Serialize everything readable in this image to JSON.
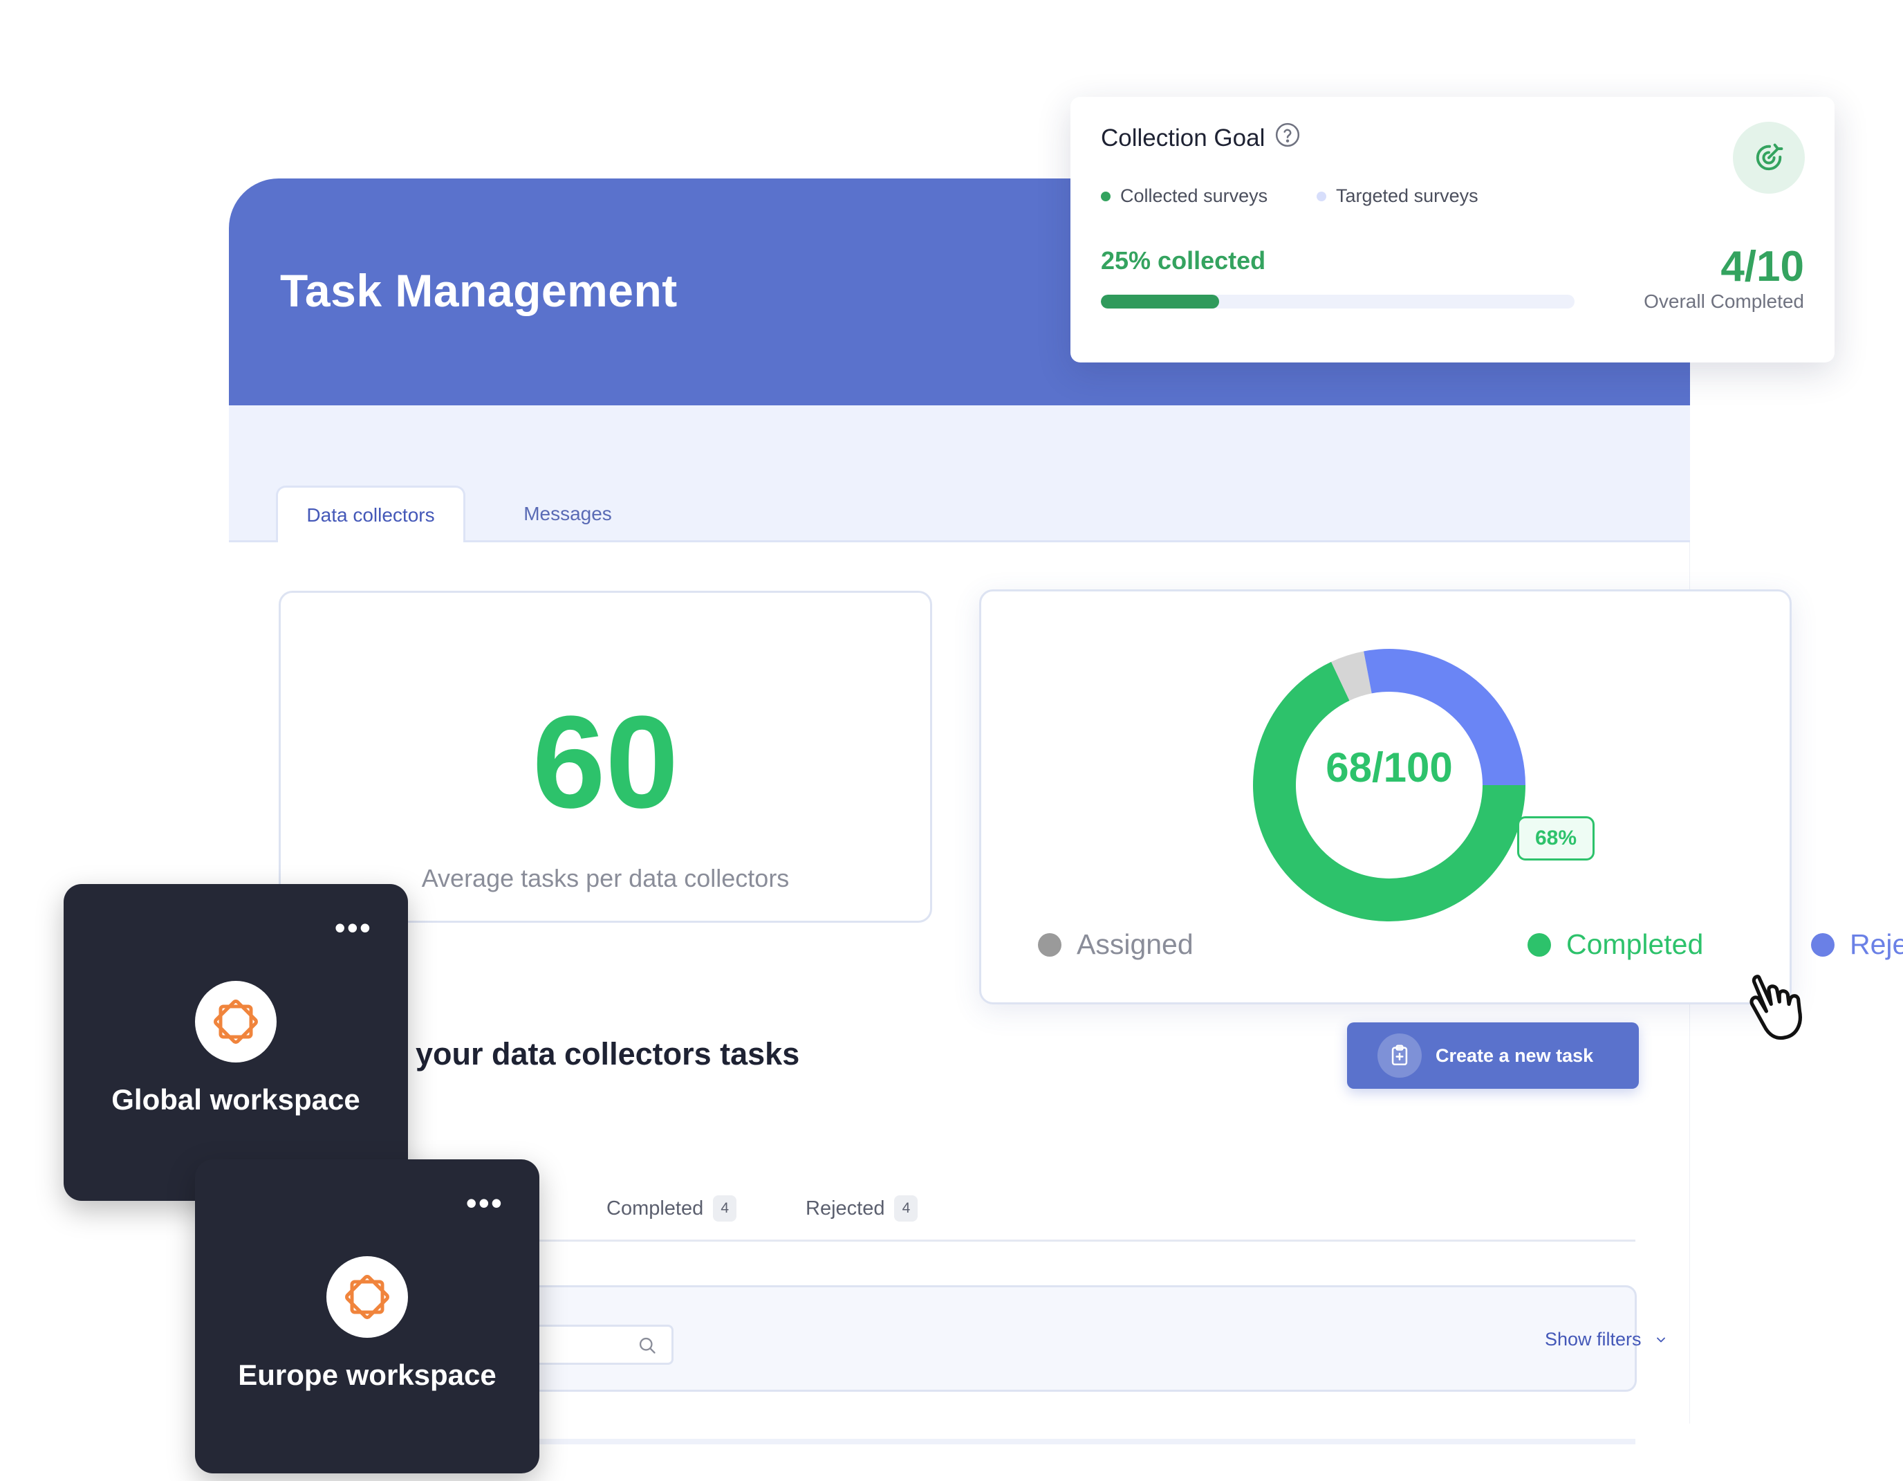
{
  "header": {
    "title": "Task Management"
  },
  "tabs": [
    {
      "label": "Data collectors",
      "active": true
    },
    {
      "label": "Messages",
      "active": false
    }
  ],
  "average_card": {
    "value": "60",
    "label": "Average tasks per data collectors"
  },
  "donut": {
    "center_label": "68/100",
    "bubble_label": "68%",
    "segments": [
      {
        "name": "Assigned",
        "value": 4,
        "color": "#d5d5d5"
      },
      {
        "name": "Completed",
        "value": 68,
        "color": "#2dc26b"
      },
      {
        "name": "Rejected",
        "value": 28,
        "color": "#6a85f5"
      }
    ],
    "legend": [
      {
        "label": "Assigned",
        "color": "#9a9a9a"
      },
      {
        "label": "Completed",
        "color": "#2dc26b"
      },
      {
        "label": "Rejected",
        "color": "#6a80e6"
      }
    ]
  },
  "section": {
    "title": "your data collectors tasks"
  },
  "create_button": {
    "label": "Create a new task",
    "icon": "clipboard-plus-icon"
  },
  "sub_tabs": [
    {
      "label": "Completed",
      "count": "4"
    },
    {
      "label": "Rejected",
      "count": "4"
    }
  ],
  "filters": {
    "search_value": "",
    "search_icon": "search-icon",
    "show_filters_label": "Show filters"
  },
  "collection_goal": {
    "title": "Collection Goal",
    "legend": [
      {
        "label": "Collected surveys",
        "color": "#34a35f"
      },
      {
        "label": "Targeted surveys",
        "color": "#d7defb"
      }
    ],
    "percent_label": "25% collected",
    "progress": 0.25,
    "count": "4/10",
    "count_label": "Overall Completed",
    "badge_icon": "target-icon"
  },
  "workspaces": [
    {
      "name": "Global workspace",
      "more": "•••"
    },
    {
      "name": "Europe workspace",
      "more": "•••"
    }
  ],
  "colors": {
    "primary": "#5a72cc",
    "success": "#2dc26b",
    "dark_card": "#252836",
    "logo": "#f0843c"
  }
}
